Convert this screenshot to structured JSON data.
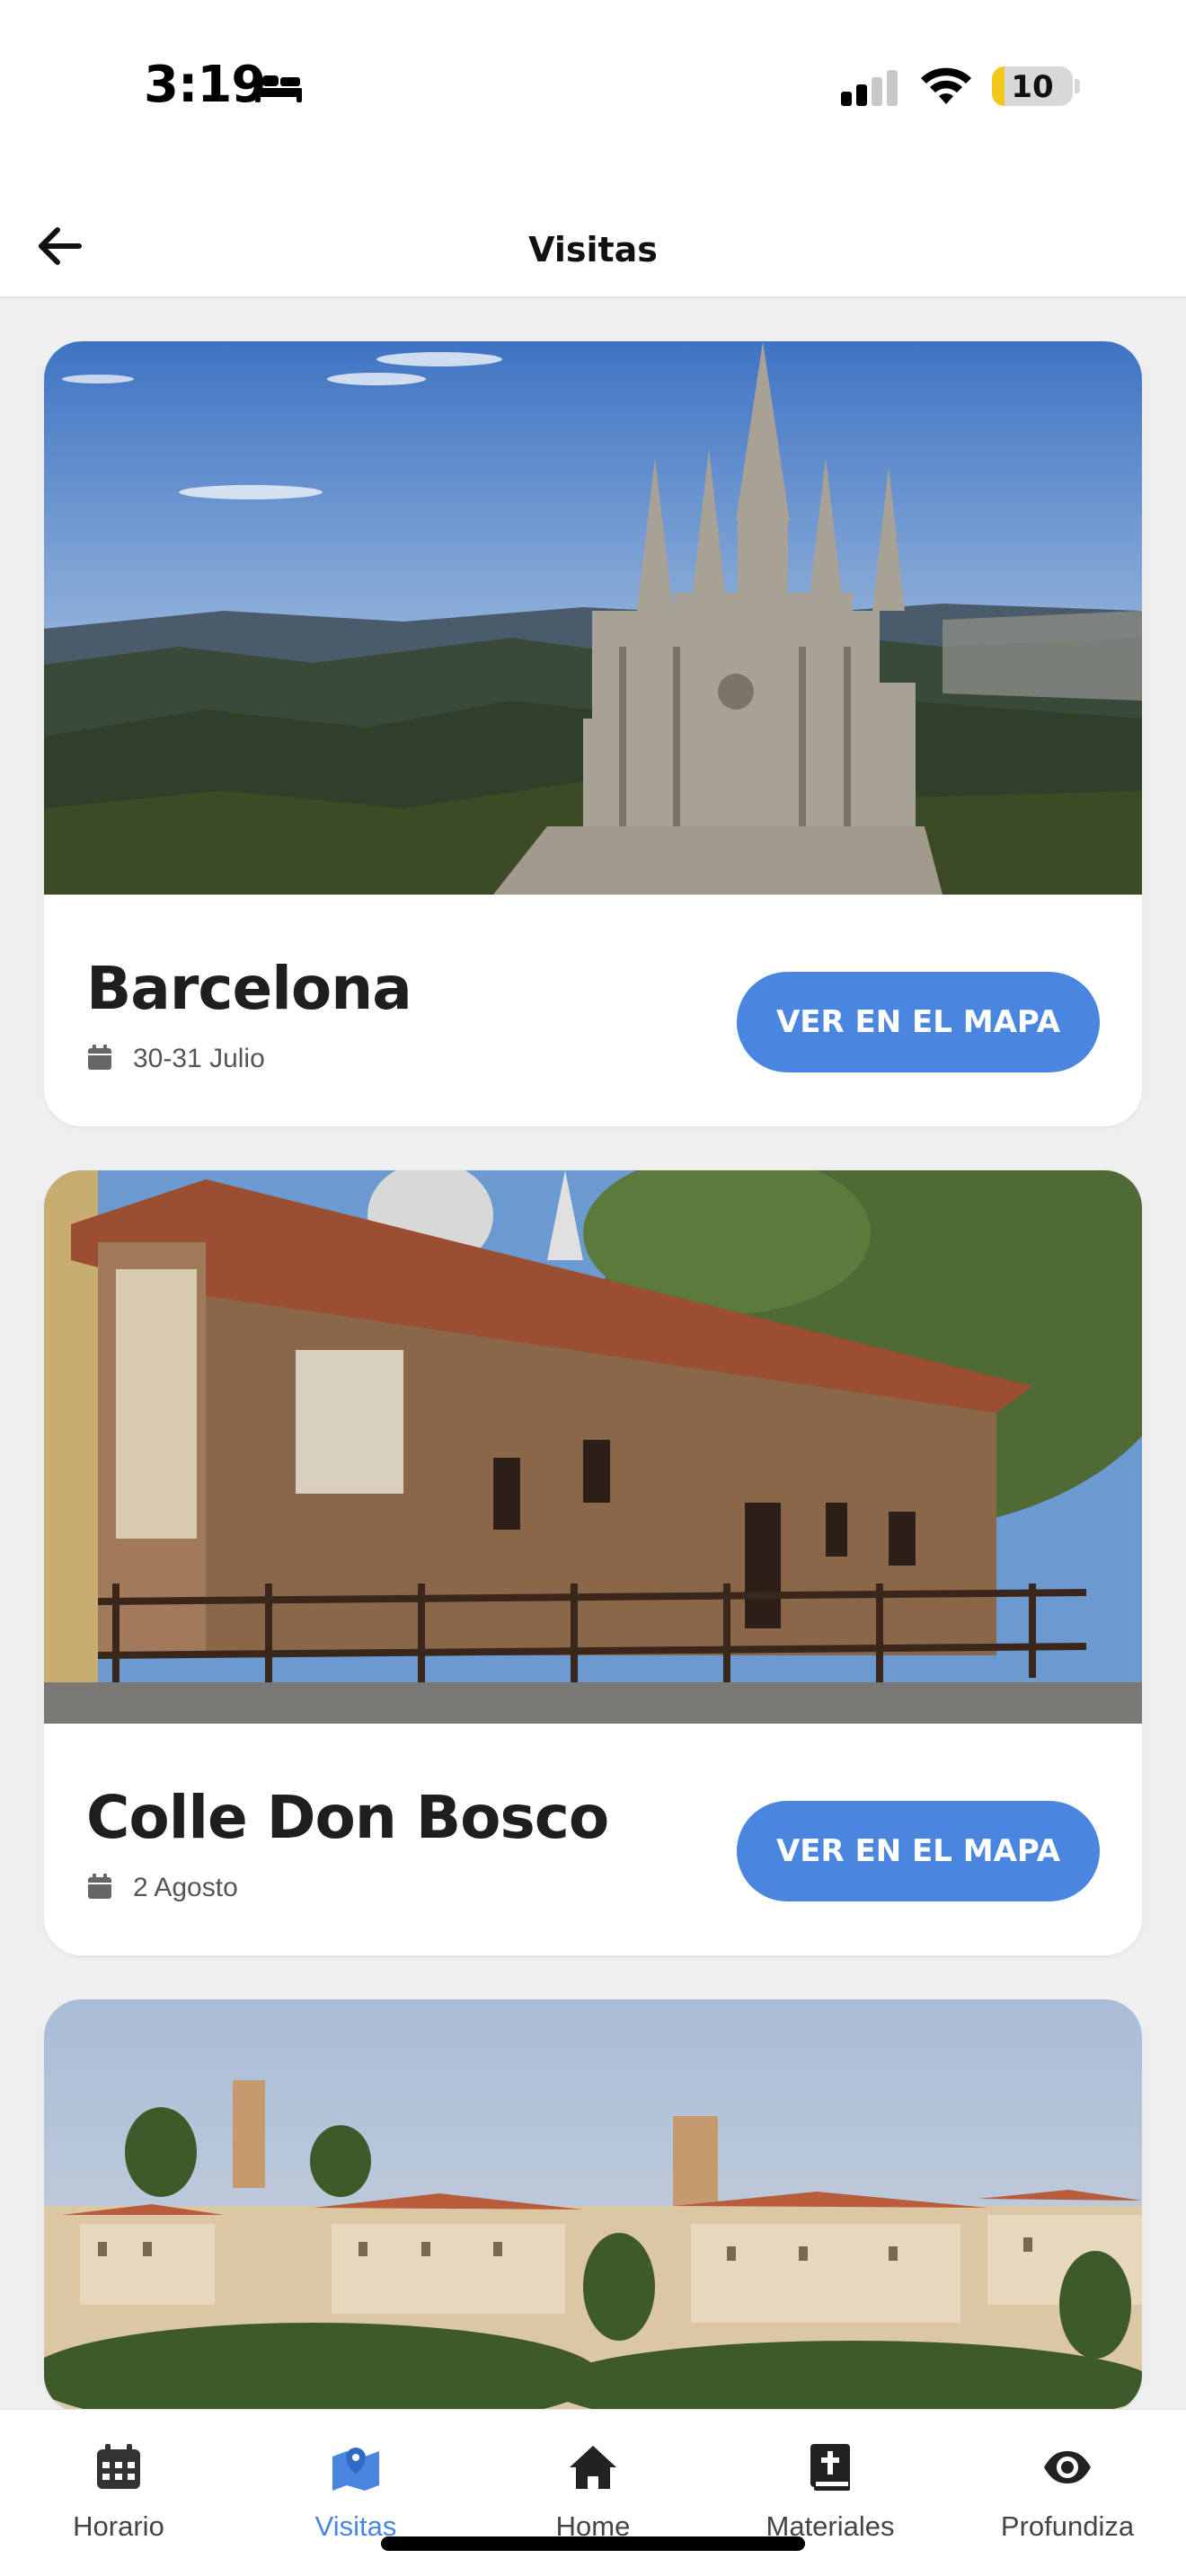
{
  "status_bar": {
    "time": "3:19",
    "battery": "10",
    "battery_level": 0.1,
    "icons": [
      "bed-icon",
      "cellular-signal-icon",
      "wifi-icon",
      "battery-icon"
    ]
  },
  "header": {
    "title": "Visitas",
    "back_icon": "arrow-left-icon"
  },
  "visits": [
    {
      "title": "Barcelona",
      "date": "30-31 Julio",
      "button": "VER EN EL MAPA",
      "image": "sagrat-cor-tibidabo-church"
    },
    {
      "title": "Colle Don Bosco",
      "date": "2 Agosto",
      "button": "VER EN EL MAPA",
      "image": "brick-farmhouse"
    },
    {
      "title": "",
      "date": "",
      "button": "",
      "image": "hilltop-italian-town"
    }
  ],
  "nav": {
    "items": [
      {
        "label": "Horario",
        "icon": "calendar-icon",
        "active": false
      },
      {
        "label": "Visitas",
        "icon": "map-pin-icon",
        "active": true
      },
      {
        "label": "Home",
        "icon": "home-icon",
        "active": false
      },
      {
        "label": "Materiales",
        "icon": "bible-icon",
        "active": false
      },
      {
        "label": "Profundiza",
        "icon": "eye-icon",
        "active": false
      }
    ]
  },
  "colors": {
    "accent": "#4a86e0",
    "background": "#efefef",
    "card": "#ffffff",
    "battery": "#f2c81a"
  }
}
